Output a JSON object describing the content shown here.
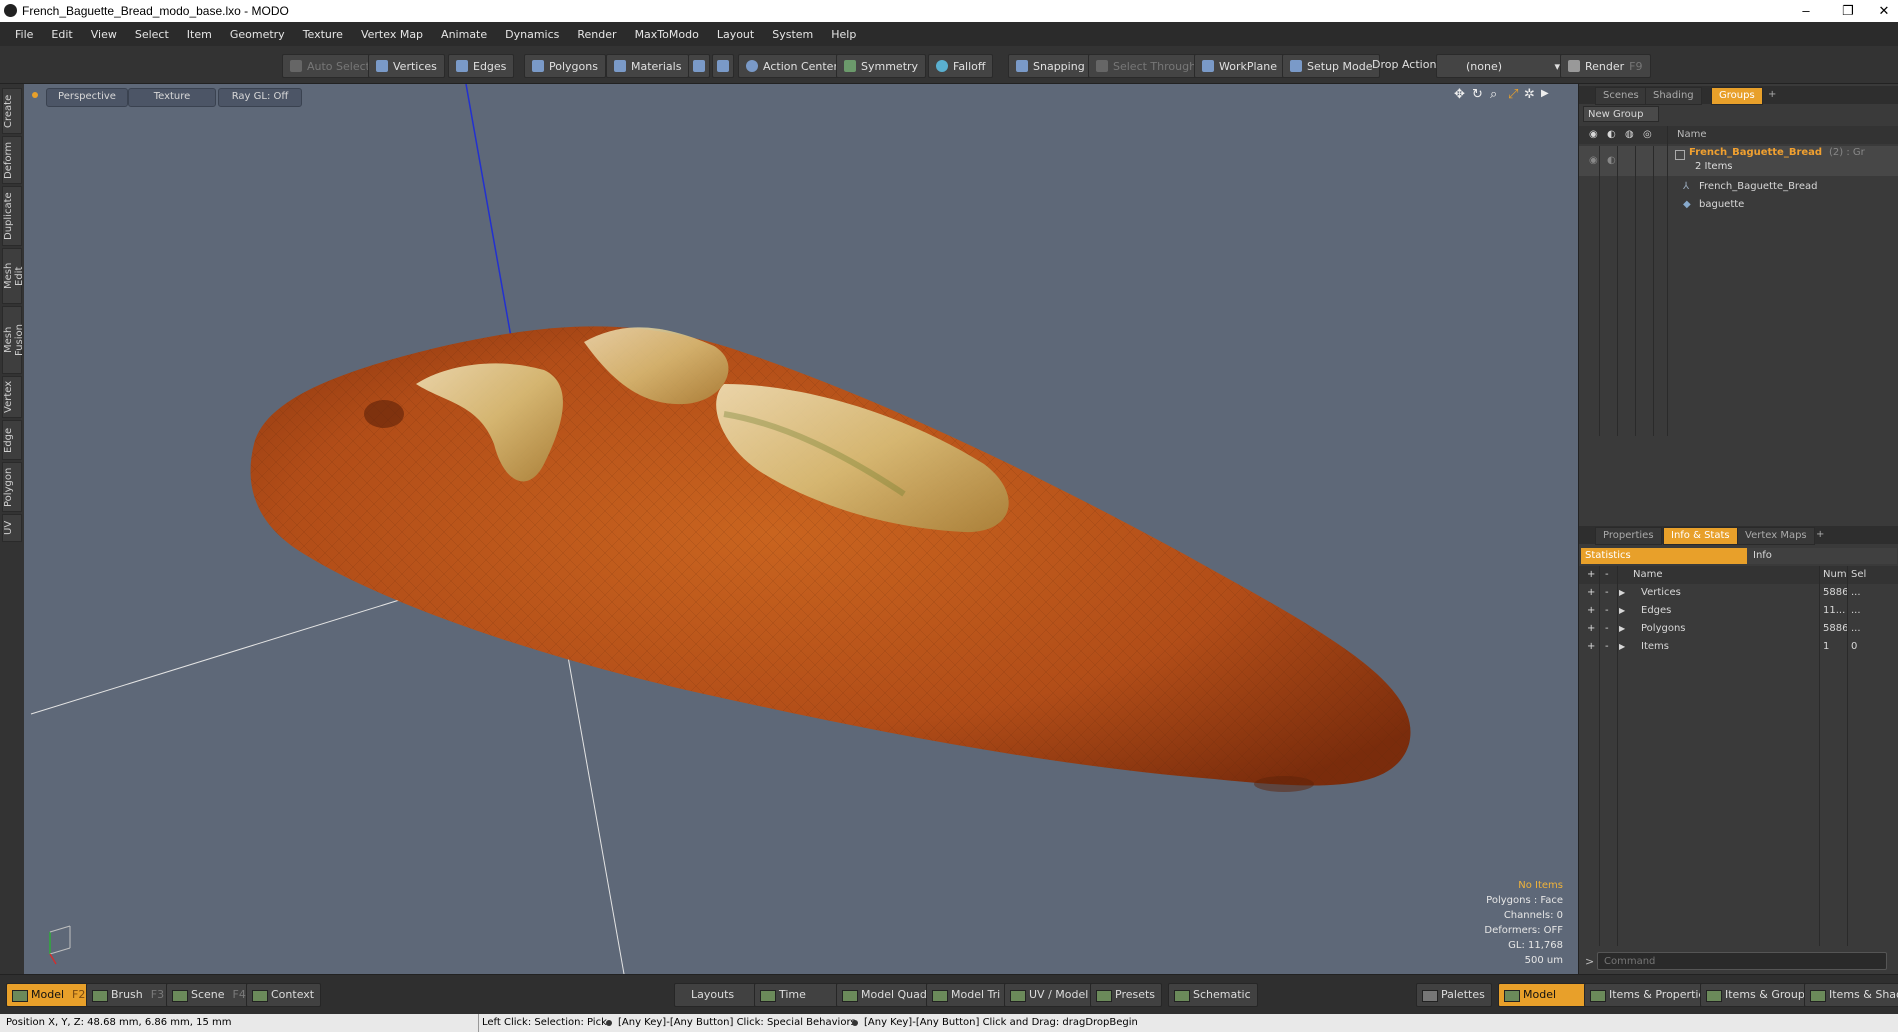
{
  "window": {
    "title": "French_Baguette_Bread_modo_base.lxo - MODO",
    "minimize": "–",
    "restore": "❐",
    "close": "✕"
  },
  "menu": [
    "File",
    "Edit",
    "View",
    "Select",
    "Item",
    "Geometry",
    "Texture",
    "Vertex Map",
    "Animate",
    "Dynamics",
    "Render",
    "MaxToModo",
    "Layout",
    "System",
    "Help"
  ],
  "toolbar": {
    "auto_select": "Auto Select",
    "vertices": "Vertices",
    "edges": "Edges",
    "polygons": "Polygons",
    "materials": "Materials",
    "action_center": "Action Center",
    "symmetry": "Symmetry",
    "falloff": "Falloff",
    "snapping": "Snapping",
    "select_through": "Select Through",
    "workplane": "WorkPlane",
    "setup_mode": "Setup Mode",
    "drop_action": "Drop Action",
    "drop_action_value": "(none)",
    "render": "Render",
    "render_key": "F9"
  },
  "left_tabs": [
    "Create",
    "Deform",
    "Duplicate",
    "Mesh Edit",
    "Mesh Fusion",
    "Vertex",
    "Edge",
    "Polygon",
    "UV"
  ],
  "viewport": {
    "view_mode": "Perspective",
    "shading": "Texture",
    "ray_gl": "Ray GL: Off",
    "info": {
      "selection": "No Items",
      "polygons": "Polygons : Face",
      "channels": "Channels: 0",
      "deformers": "Deformers: OFF",
      "gl": "GL: 11,768",
      "scale": "500 um"
    }
  },
  "scene_panel": {
    "tabs": [
      "Scenes",
      "Shading",
      "Groups"
    ],
    "active_tab": "Groups",
    "add": "+",
    "new_group": "New Group",
    "column_name": "Name",
    "group_name": "French_Baguette_Bread",
    "group_suffix": "(2) : Gr",
    "group_count": "2 Items",
    "children": [
      "French_Baguette_Bread",
      "baguette"
    ]
  },
  "stats_panel": {
    "tabs": [
      "Properties",
      "Info & Stats",
      "Vertex Maps"
    ],
    "active_tab": "Info & Stats",
    "add": "+",
    "subtabs": [
      "Statistics",
      "Info"
    ],
    "col_name": "Name",
    "col_num": "Num",
    "col_sel": "Sel",
    "rows": [
      {
        "name": "Vertices",
        "num": "5886",
        "sel": "..."
      },
      {
        "name": "Edges",
        "num": "11...",
        "sel": "..."
      },
      {
        "name": "Polygons",
        "num": "5886",
        "sel": "..."
      },
      {
        "name": "Items",
        "num": "1",
        "sel": "0"
      }
    ],
    "command_placeholder": "Command"
  },
  "bottom_bar": {
    "model": "Model",
    "model_key": "F2",
    "brush": "Brush",
    "brush_key": "F3",
    "scene": "Scene",
    "scene_key": "F4",
    "context": "Context",
    "layouts": "Layouts",
    "time": "Time",
    "model_quad": "Model Quad",
    "model_tri": "Model Tri",
    "uv_model": "UV / Model",
    "presets": "Presets",
    "schematic": "Schematic",
    "palettes": "Palettes",
    "model_right": "Model",
    "items_properties": "Items & Properties",
    "items_groups": "Items & Groups",
    "items_shading": "Items & Shadin"
  },
  "status": {
    "position": "Position X, Y, Z:   48.68 mm, 6.86 mm, 15 mm",
    "hint1": "Left Click: Selection: Pick",
    "hint2": "[Any Key]-[Any Button] Click: Special Behaviors",
    "hint3": "[Any Key]-[Any Button] Click and Drag: dragDropBegin"
  },
  "colors": {
    "accent": "#e8a02a",
    "viewport_bg": "#5e6878",
    "bread_crust": "#b8501a"
  }
}
